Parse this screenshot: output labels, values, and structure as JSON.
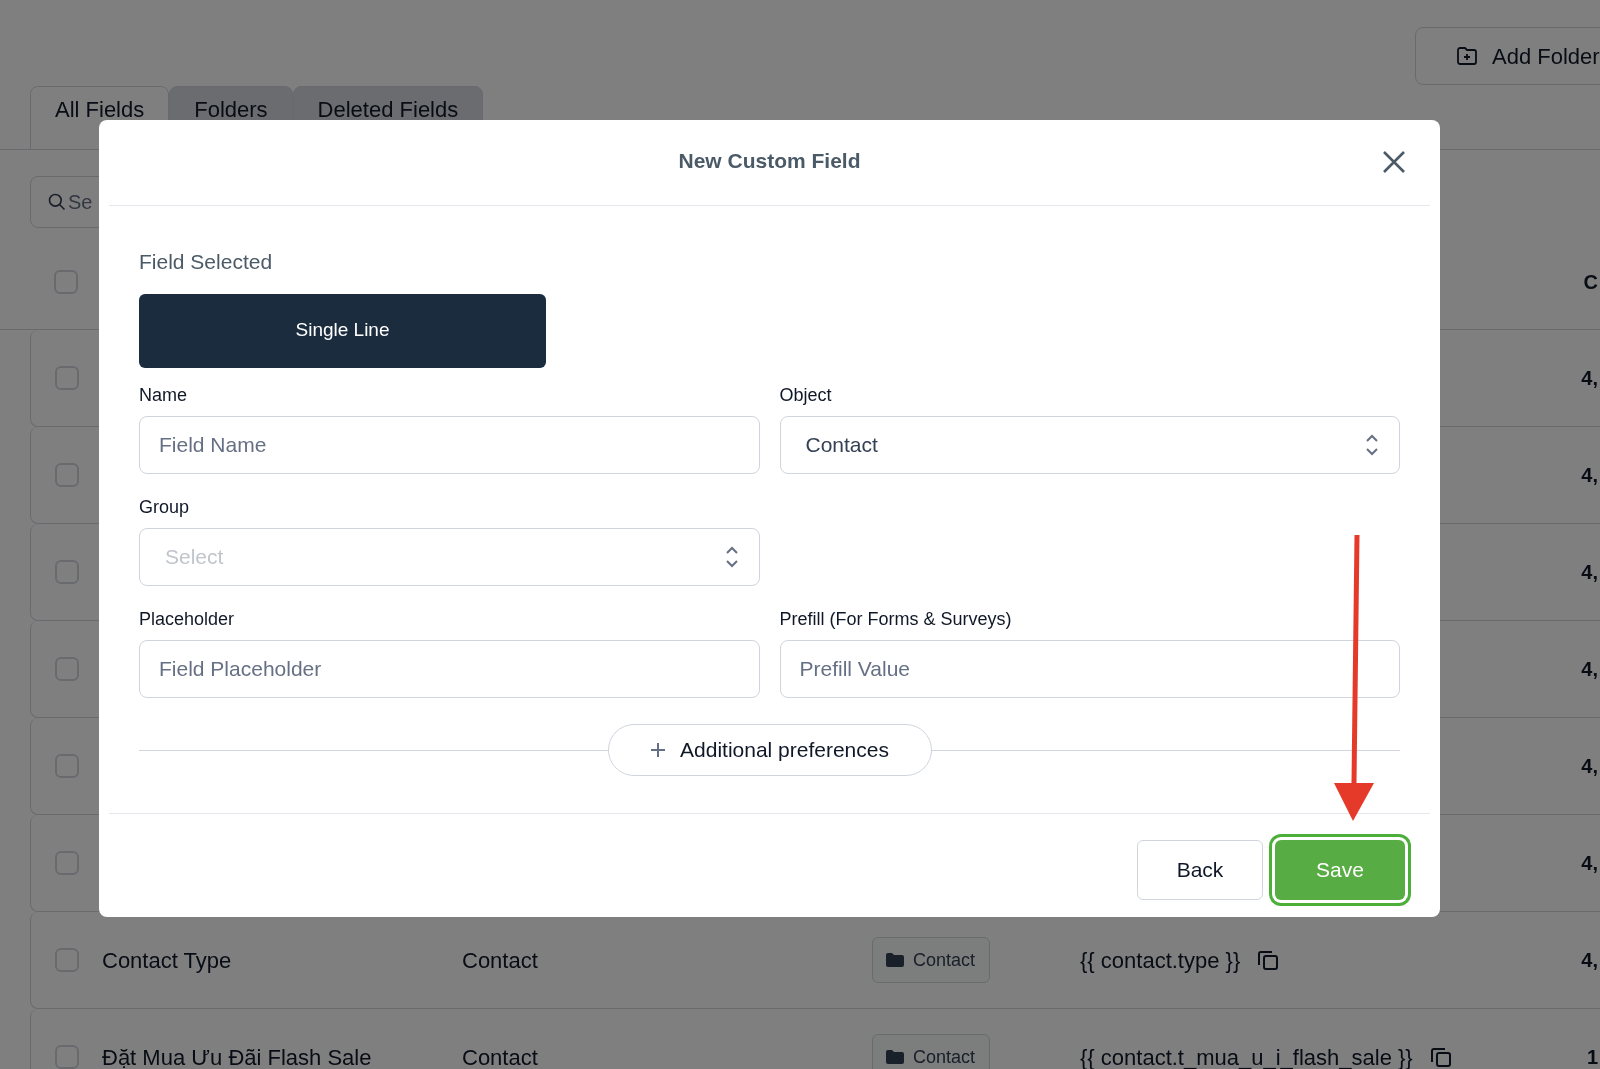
{
  "background": {
    "add_folder_button": "Add Folder",
    "tabs": [
      {
        "label": "All Fields",
        "selected": true
      },
      {
        "label": "Folders",
        "selected": false
      },
      {
        "label": "Deleted Fields",
        "selected": false
      }
    ],
    "search": {
      "placeholder": "Se"
    },
    "table": {
      "header": {
        "checked": false,
        "column_last": "C"
      },
      "rows": [
        {
          "checked": false,
          "column_last": "4,"
        },
        {
          "checked": false,
          "column_last": "4,"
        },
        {
          "checked": false,
          "column_last": "4,"
        },
        {
          "checked": false,
          "column_last": "4,"
        },
        {
          "checked": false,
          "column_last": "4,"
        },
        {
          "checked": false,
          "column_last": "4,"
        },
        {
          "checked": false,
          "name": "Contact Type",
          "object": "Contact",
          "folder": "Contact",
          "key": "{{ contact.type }}",
          "column_last": "4,"
        },
        {
          "checked": false,
          "name": "Đặt Mua Ưu Đãi Flash Sale",
          "object": "Contact",
          "folder": "Contact",
          "key": "{{ contact.t_mua_u_i_flash_sale }}",
          "column_last": "1"
        }
      ]
    }
  },
  "modal": {
    "title": "New Custom Field",
    "field_selected_label": "Field Selected",
    "field_type": "Single Line",
    "field_rows": [
      [
        {
          "label": "Name",
          "kind": "input",
          "placeholder": "Field Name"
        },
        {
          "label": "Object",
          "kind": "select",
          "value": "Contact"
        }
      ],
      [
        {
          "label": "Group",
          "kind": "select",
          "placeholder": "Select"
        }
      ],
      [
        {
          "label": "Placeholder",
          "kind": "input",
          "placeholder": "Field Placeholder"
        },
        {
          "label": "Prefill (For Forms & Surveys)",
          "kind": "input",
          "placeholder": "Prefill Value"
        }
      ]
    ],
    "additional_button": "Additional preferences",
    "buttons": [
      {
        "label": "Back",
        "kind": "secondary",
        "highlighted": false
      },
      {
        "label": "Save",
        "kind": "primary",
        "highlighted": true
      }
    ]
  }
}
